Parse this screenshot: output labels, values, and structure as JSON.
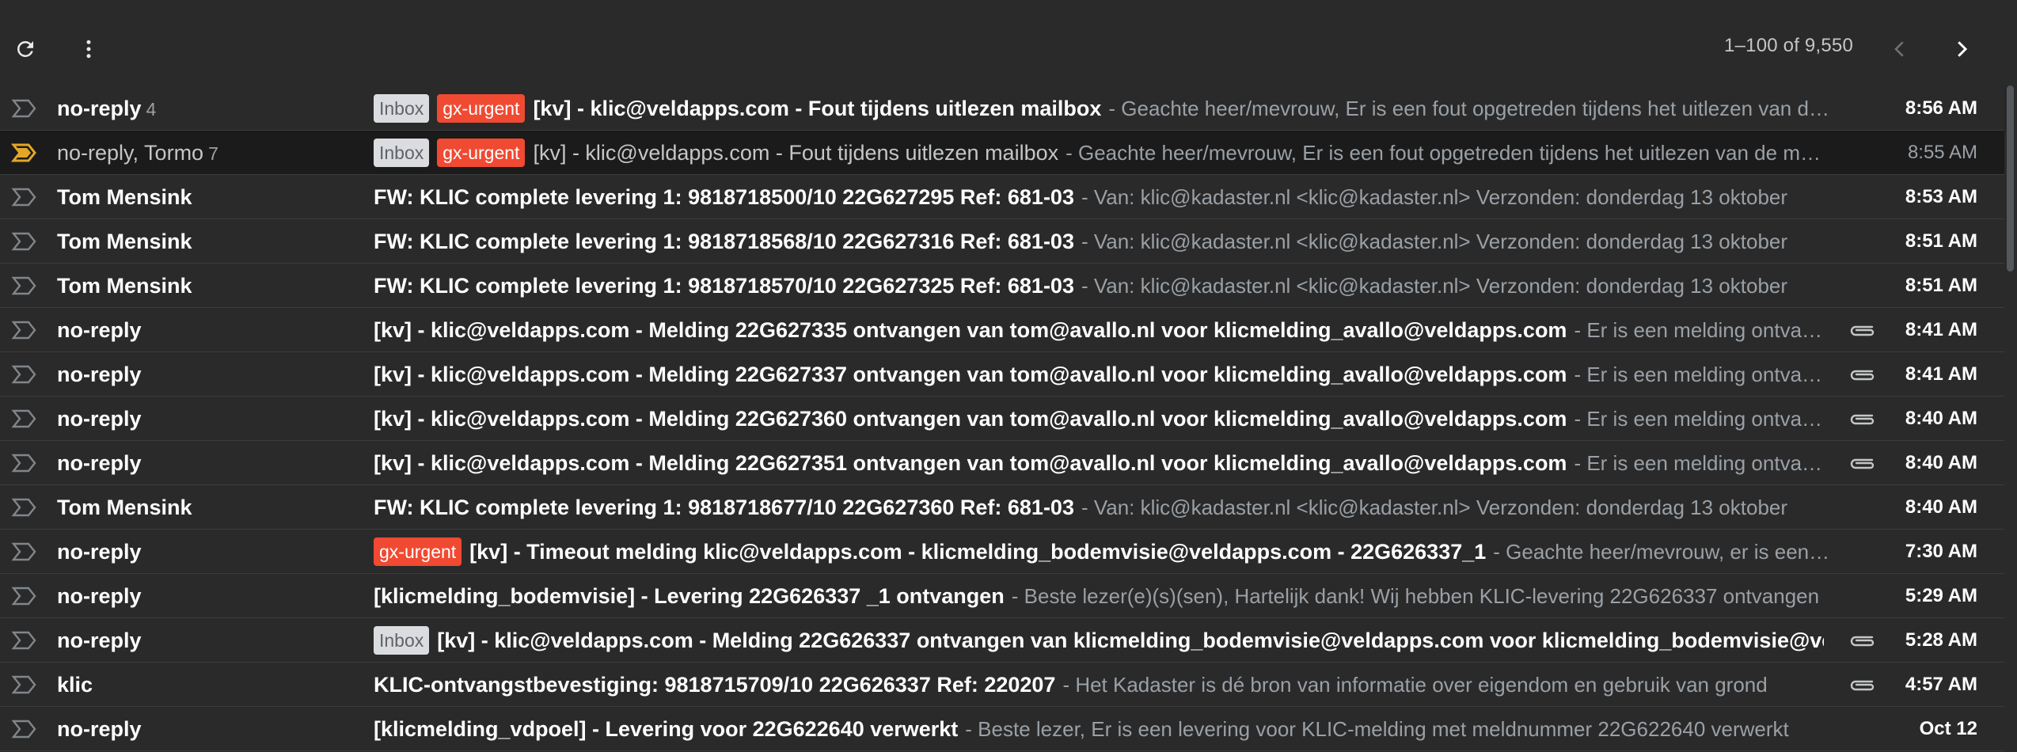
{
  "toolbar": {
    "refresh_icon": "refresh-icon",
    "more_icon": "more-vert-icon",
    "range": "1–100 of 9,550",
    "prev_icon": "chevron-left-icon",
    "next_icon": "chevron-right-icon"
  },
  "colors": {
    "background": "#2a2a2a",
    "selected_row": "#1b1b1b",
    "urgent_label": "#f04a32",
    "inbox_label": "#dadce0",
    "importance_marker_active": "#e3a628"
  },
  "emails": [
    {
      "sender": "no-reply",
      "count": "4",
      "labels": [
        "Inbox",
        "gx-urgent"
      ],
      "subject": "[kv] - klic@veldapps.com - Fout tijdens uitlezen mailbox",
      "snippet": "- Geachte heer/mevrouw, Er is een fout opgetreden tijdens het uitlezen van de mailbox",
      "time": "8:56 AM",
      "attachment": false,
      "unread": true
    },
    {
      "sender": "no-reply, Tormo",
      "count": "7",
      "labels": [
        "Inbox",
        "gx-urgent"
      ],
      "subject": "[kv] - klic@veldapps.com - Fout tijdens uitlezen mailbox",
      "snippet": "- Geachte heer/mevrouw, Er is een fout opgetreden tijdens het uitlezen van de mailbox",
      "time": "8:55 AM",
      "attachment": false,
      "unread": false
    },
    {
      "sender": "Tom Mensink",
      "count": "",
      "labels": [],
      "subject": "FW: KLIC complete levering 1: 9818718500/10 22G627295 Ref: 681-03",
      "snippet": "- Van: klic@kadaster.nl <klic@kadaster.nl> Verzonden: donderdag 13 oktober",
      "time": "8:53 AM",
      "attachment": false,
      "unread": true
    },
    {
      "sender": "Tom Mensink",
      "count": "",
      "labels": [],
      "subject": "FW: KLIC complete levering 1: 9818718568/10 22G627316 Ref: 681-03",
      "snippet": "- Van: klic@kadaster.nl <klic@kadaster.nl> Verzonden: donderdag 13 oktober",
      "time": "8:51 AM",
      "attachment": false,
      "unread": true
    },
    {
      "sender": "Tom Mensink",
      "count": "",
      "labels": [],
      "subject": "FW: KLIC complete levering 1: 9818718570/10 22G627325 Ref: 681-03",
      "snippet": "- Van: klic@kadaster.nl <klic@kadaster.nl> Verzonden: donderdag 13 oktober",
      "time": "8:51 AM",
      "attachment": false,
      "unread": true
    },
    {
      "sender": "no-reply",
      "count": "",
      "labels": [],
      "subject": "[kv] - klic@veldapps.com - Melding 22G627335 ontvangen van tom@avallo.nl voor klicmelding_avallo@veldapps.com",
      "snippet": "- Er is een melding ontvangen",
      "time": "8:41 AM",
      "attachment": true,
      "unread": true
    },
    {
      "sender": "no-reply",
      "count": "",
      "labels": [],
      "subject": "[kv] - klic@veldapps.com - Melding 22G627337 ontvangen van tom@avallo.nl voor klicmelding_avallo@veldapps.com",
      "snippet": "- Er is een melding ontvangen",
      "time": "8:41 AM",
      "attachment": true,
      "unread": true
    },
    {
      "sender": "no-reply",
      "count": "",
      "labels": [],
      "subject": "[kv] - klic@veldapps.com - Melding 22G627360 ontvangen van tom@avallo.nl voor klicmelding_avallo@veldapps.com",
      "snippet": "- Er is een melding ontvangen",
      "time": "8:40 AM",
      "attachment": true,
      "unread": true
    },
    {
      "sender": "no-reply",
      "count": "",
      "labels": [],
      "subject": "[kv] - klic@veldapps.com - Melding 22G627351 ontvangen van tom@avallo.nl voor klicmelding_avallo@veldapps.com",
      "snippet": "- Er is een melding ontvangen",
      "time": "8:40 AM",
      "attachment": true,
      "unread": true
    },
    {
      "sender": "Tom Mensink",
      "count": "",
      "labels": [],
      "subject": "FW: KLIC complete levering 1: 9818718677/10 22G627360 Ref: 681-03",
      "snippet": "- Van: klic@kadaster.nl <klic@kadaster.nl> Verzonden: donderdag 13 oktober",
      "time": "8:40 AM",
      "attachment": false,
      "unread": true
    },
    {
      "sender": "no-reply",
      "count": "",
      "labels": [
        "gx-urgent"
      ],
      "subject": "[kv] - Timeout melding klic@veldapps.com - klicmelding_bodemvisie@veldapps.com - 22G626337_1",
      "snippet": "- Geachte heer/mevrouw, er is een timeout opgetreden",
      "time": "7:30 AM",
      "attachment": false,
      "unread": true
    },
    {
      "sender": "no-reply",
      "count": "",
      "labels": [],
      "subject": "[klicmelding_bodemvisie] - Levering 22G626337 _1 ontvangen",
      "snippet": "- Beste lezer(e)(s)(sen), Hartelijk dank! Wij hebben KLIC-levering 22G626337 ontvangen",
      "time": "5:29 AM",
      "attachment": false,
      "unread": true
    },
    {
      "sender": "no-reply",
      "count": "",
      "labels": [
        "Inbox"
      ],
      "subject": "[kv] - klic@veldapps.com - Melding 22G626337 ontvangen van klicmelding_bodemvisie@veldapps.com voor klicmelding_bodemvisie@veldapps.com",
      "snippet": "",
      "time": "5:28 AM",
      "attachment": true,
      "unread": true
    },
    {
      "sender": "klic",
      "count": "",
      "labels": [],
      "subject": "KLIC-ontvangstbevestiging: 9818715709/10 22G626337 Ref: 220207",
      "snippet": "- Het Kadaster is dé bron van informatie over eigendom en gebruik van grond",
      "time": "4:57 AM",
      "attachment": true,
      "unread": true
    },
    {
      "sender": "no-reply",
      "count": "",
      "labels": [],
      "subject": "[klicmelding_vdpoel] - Levering voor 22G622640 verwerkt",
      "snippet": "- Beste lezer, Er is een levering voor KLIC-melding met meldnummer 22G622640 verwerkt",
      "time": "Oct 12",
      "attachment": false,
      "unread": true
    }
  ]
}
